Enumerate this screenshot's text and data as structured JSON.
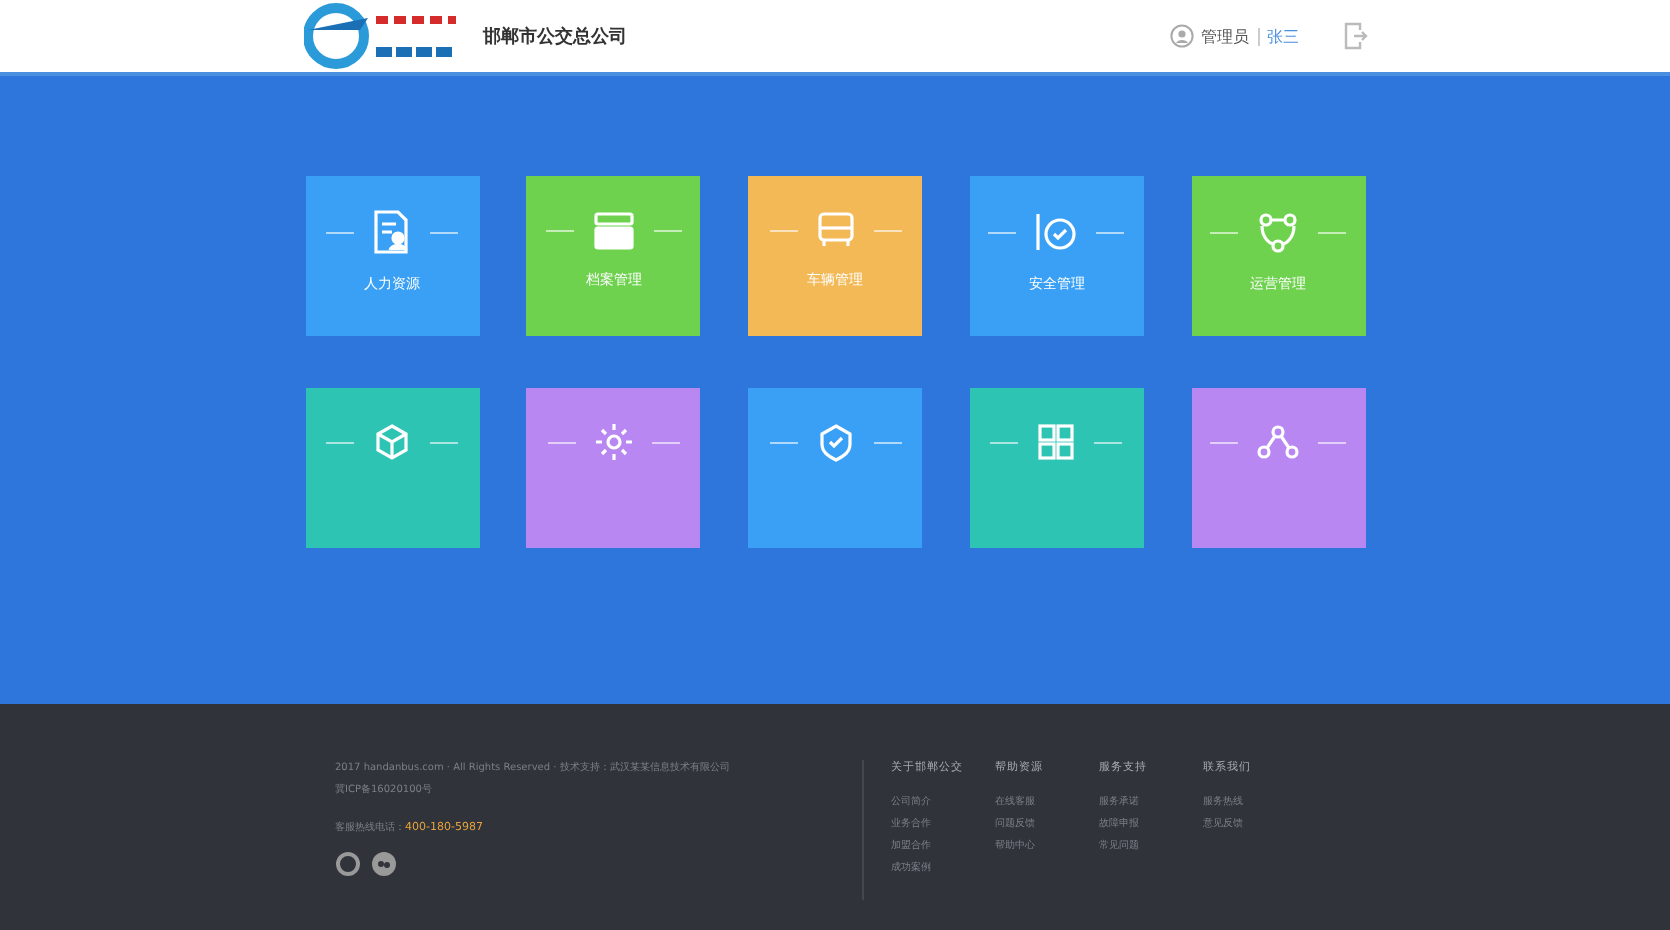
{
  "header": {
    "company": "邯郸市公交总公司",
    "user_role": "管理员",
    "user_name": "张三"
  },
  "tiles": [
    {
      "label": "人力资源",
      "color": "#3aa0f5"
    },
    {
      "label": "档案管理",
      "color": "#6fd24f"
    },
    {
      "label": "车辆管理",
      "color": "#f3b957"
    },
    {
      "label": "安全管理",
      "color": "#3aa0f5"
    },
    {
      "label": "运营管理",
      "color": "#6fd24f"
    },
    {
      "color": "#2ec4b4"
    },
    {
      "color": "#b987f2"
    },
    {
      "color": "#3aa0f5"
    },
    {
      "color": "#2ec4b4"
    },
    {
      "color": "#b987f2"
    }
  ],
  "footer": {
    "copyright": "2017 handanbus.com · All Rights Reserved · 技术支持：武汉某某信息技术有限公司",
    "icp": "冀ICP备16020100号",
    "hotline_label": "客服热线电话：",
    "hotline": "400-180-5987",
    "columns": [
      {
        "title": "关于邯郸公交",
        "links": [
          "公司简介",
          "业务合作",
          "加盟合作",
          "成功案例"
        ]
      },
      {
        "title": "帮助资源",
        "links": [
          "在线客服",
          "问题反馈",
          "帮助中心"
        ]
      },
      {
        "title": "服务支持",
        "links": [
          "服务承诺",
          "故障申报",
          "常见问题"
        ]
      },
      {
        "title": "联系我们",
        "links": [
          "服务热线",
          "意见反馈"
        ]
      }
    ]
  }
}
